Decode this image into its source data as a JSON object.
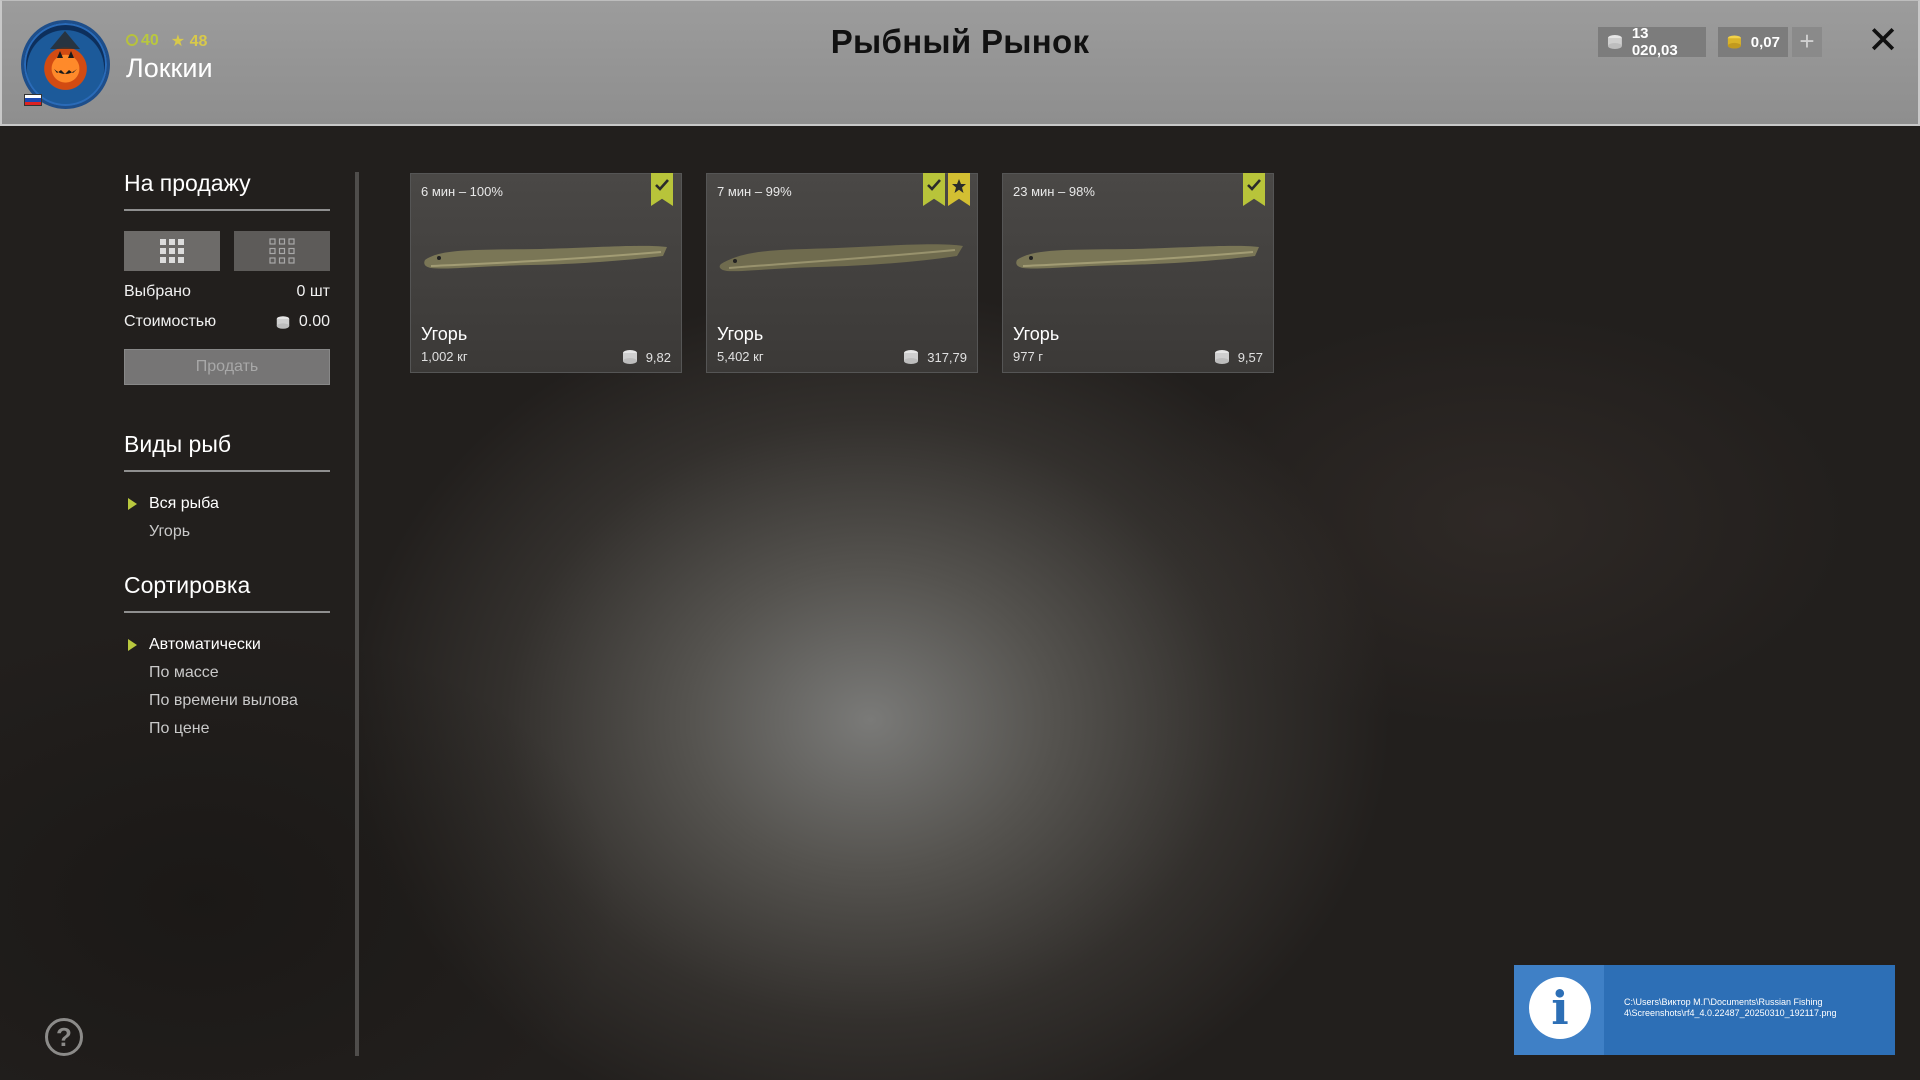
{
  "header": {
    "title": "Рыбный Рынок",
    "username": "Локкии",
    "level": "40",
    "rank": "48",
    "silver": "13 020,03",
    "gold": "0,07",
    "plus_label": "+",
    "close_label": "✕"
  },
  "sidebar": {
    "for_sale_title": "На продажу",
    "selected_label": "Выбрано",
    "selected_value": "0 шт",
    "cost_label": "Стоимостью",
    "cost_value": "0.00",
    "sell_button": "Продать",
    "species_title": "Виды рыб",
    "species": [
      {
        "label": "Вся рыба",
        "active": true
      },
      {
        "label": "Угорь",
        "active": false
      }
    ],
    "sort_title": "Сортировка",
    "sort_options": [
      {
        "label": "Автоматически",
        "active": true
      },
      {
        "label": "По массе",
        "active": false
      },
      {
        "label": "По времени вылова",
        "active": false
      },
      {
        "label": "По цене",
        "active": false
      }
    ]
  },
  "fish_cards": [
    {
      "timer": "6 мин – 100%",
      "name": "Угорь",
      "weight": "1,002 кг",
      "price": "9,82",
      "checked": true,
      "starred": false
    },
    {
      "timer": "7 мин – 99%",
      "name": "Угорь",
      "weight": "5,402 кг",
      "price": "317,79",
      "checked": true,
      "starred": true
    },
    {
      "timer": "23 мин – 98%",
      "name": "Угорь",
      "weight": "977 г",
      "price": "9,57",
      "checked": true,
      "starred": false
    }
  ],
  "help_label": "?",
  "toast": {
    "icon": "info-icon",
    "path": "C:\\Users\\Виктор М.Г\\Documents\\Russian Fishing 4\\Screenshots\\rf4_4.0.22487_20250310_192117.png"
  },
  "colors": {
    "accent_green": "#b8c43a",
    "accent_gold": "#d3bf32",
    "toast_blue": "#2d6fb6"
  }
}
